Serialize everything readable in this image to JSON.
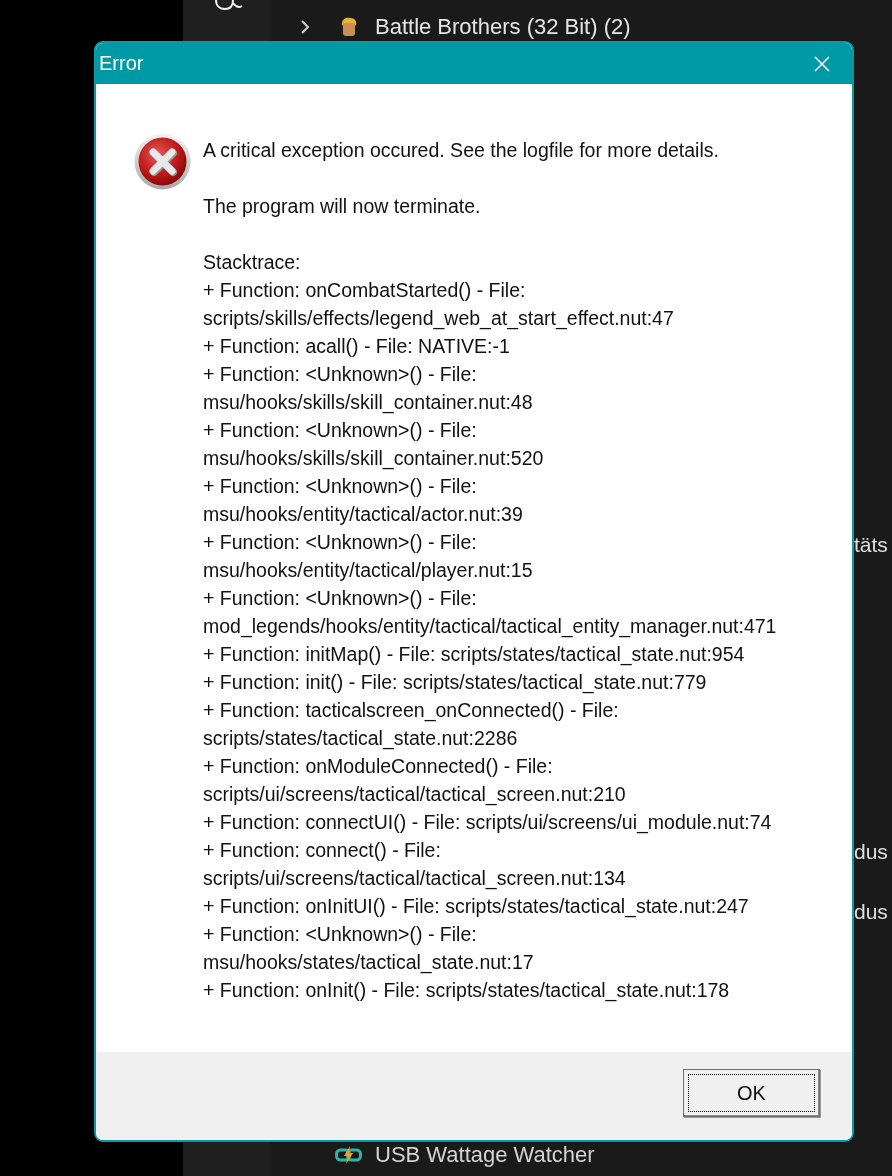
{
  "background": {
    "list_item": {
      "label": "Battle Brothers (32 Bit) (2)"
    },
    "side_fragments": [
      "täts",
      "dus",
      "dus"
    ],
    "bottom_item": {
      "label": "USB Wattage Watcher"
    }
  },
  "dialog": {
    "title": "Error",
    "message": "A critical exception occured. See the logfile for more details.",
    "notice": "The program will now terminate.",
    "stacktrace_label": "Stacktrace:",
    "stacktrace_lines": [
      "+ Function: onCombatStarted() - File:",
      "scripts/skills/effects/legend_web_at_start_effect.nut:47",
      "+ Function: acall() - File: NATIVE:-1",
      "+ Function: <Unknown>() - File:",
      "msu/hooks/skills/skill_container.nut:48",
      "+ Function: <Unknown>() - File:",
      "msu/hooks/skills/skill_container.nut:520",
      "+ Function: <Unknown>() - File:",
      "msu/hooks/entity/tactical/actor.nut:39",
      "+ Function: <Unknown>() - File:",
      "msu/hooks/entity/tactical/player.nut:15",
      "+ Function: <Unknown>() - File:",
      "mod_legends/hooks/entity/tactical/tactical_entity_manager.nut:471",
      "+ Function: initMap() - File: scripts/states/tactical_state.nut:954",
      "+ Function: init() - File: scripts/states/tactical_state.nut:779",
      "+ Function: tacticalscreen_onConnected() - File:",
      "scripts/states/tactical_state.nut:2286",
      "+ Function: onModuleConnected() - File:",
      "scripts/ui/screens/tactical/tactical_screen.nut:210",
      "+ Function: connectUI() - File: scripts/ui/screens/ui_module.nut:74",
      "+ Function: connect() - File:",
      "scripts/ui/screens/tactical/tactical_screen.nut:134",
      "+ Function: onInitUI() - File: scripts/states/tactical_state.nut:247",
      "+ Function: <Unknown>() - File:",
      "msu/hooks/states/tactical_state.nut:17",
      "+ Function: onInit() - File: scripts/states/tactical_state.nut:178"
    ],
    "buttons": [
      {
        "label": "OK",
        "focused": true
      }
    ]
  }
}
